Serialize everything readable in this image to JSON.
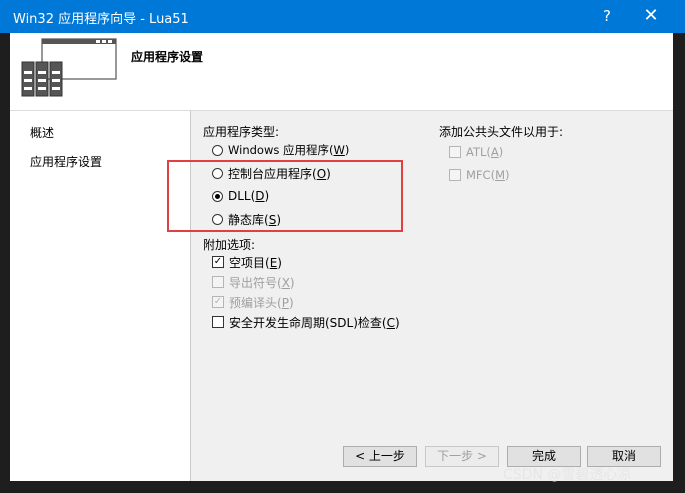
{
  "window": {
    "title": "Win32 应用程序向导 - Lua51",
    "help_glyph": "?",
    "close_glyph": "✕"
  },
  "header": {
    "title": "应用程序设置"
  },
  "nav": {
    "items": [
      "概述",
      "应用程序设置"
    ]
  },
  "app_type": {
    "label": "应用程序类型:",
    "options": [
      {
        "prefix": "Windows 应用程序(",
        "key": "W",
        "suffix": ")",
        "selected": false
      },
      {
        "prefix": "控制台应用程序(",
        "key": "O",
        "suffix": ")",
        "selected": false
      },
      {
        "prefix": "DLL(",
        "key": "D",
        "suffix": ")",
        "selected": true
      },
      {
        "prefix": "静态库(",
        "key": "S",
        "suffix": ")",
        "selected": false
      }
    ]
  },
  "common_headers": {
    "label": "添加公共头文件以用于:",
    "options": [
      {
        "prefix": "ATL(",
        "key": "A",
        "suffix": ")",
        "checked": false,
        "disabled": true
      },
      {
        "prefix": "MFC(",
        "key": "M",
        "suffix": ")",
        "checked": false,
        "disabled": true
      }
    ]
  },
  "additional": {
    "label": "附加选项:",
    "options": [
      {
        "prefix": "空项目(",
        "key": "E",
        "suffix": ")",
        "checked": true,
        "disabled": false
      },
      {
        "prefix": "导出符号(",
        "key": "X",
        "suffix": ")",
        "checked": false,
        "disabled": true
      },
      {
        "prefix": "预编译头(",
        "key": "P",
        "suffix": ")",
        "checked": true,
        "disabled": true
      },
      {
        "prefix": "安全开发生命周期(SDL)检查(",
        "key": "C",
        "suffix": ")",
        "checked": false,
        "disabled": false
      }
    ]
  },
  "buttons": {
    "prev": "< 上一步",
    "next": "下一步 >",
    "finish": "完成",
    "cancel": "取消"
  },
  "watermark": "CSDN @雪碧透心凉",
  "colors": {
    "title_bar": "#0078d7",
    "highlight_box": "#e04040"
  }
}
